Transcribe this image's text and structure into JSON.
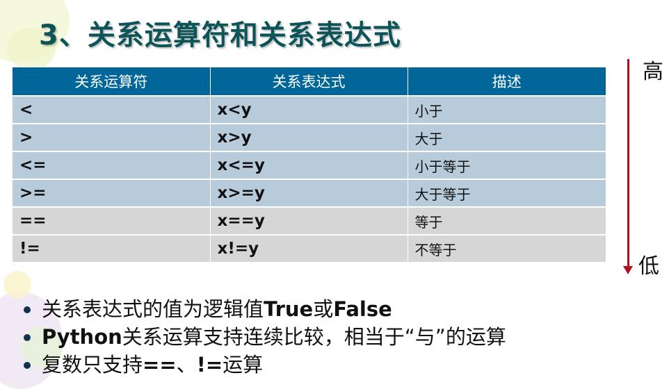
{
  "title": "3、关系运算符和关系表达式",
  "table": {
    "headers": [
      "关系运算符",
      "关系表达式",
      "描述"
    ],
    "rows": [
      {
        "op": "<",
        "expr": "x<y",
        "desc": "小于"
      },
      {
        "op": ">",
        "expr": "x>y",
        "desc": "大于"
      },
      {
        "op": "<=",
        "expr": "x<=y",
        "desc": "小于等于"
      },
      {
        "op": ">=",
        "expr": "x>=y",
        "desc": "大于等于"
      },
      {
        "op": "==",
        "expr": "x==y",
        "desc": "等于"
      },
      {
        "op": "!=",
        "expr": "x!=y",
        "desc": "不等于"
      }
    ]
  },
  "priority": {
    "high": "高",
    "low": "低",
    "arrow_color": "#b01021"
  },
  "bullets": [
    {
      "parts": [
        {
          "text": "关系表达式的值为逻辑值",
          "bold": false
        },
        {
          "text": "True",
          "bold": true
        },
        {
          "text": "或",
          "bold": false
        },
        {
          "text": "False",
          "bold": true
        }
      ]
    },
    {
      "parts": [
        {
          "text": "Python",
          "bold": true
        },
        {
          "text": "关系运算支持连续比较，相当于“与”的运算",
          "bold": false
        }
      ]
    },
    {
      "parts": [
        {
          "text": "复数只支持",
          "bold": false
        },
        {
          "text": "==",
          "bold": true
        },
        {
          "text": "、",
          "bold": false
        },
        {
          "text": "!=",
          "bold": true
        },
        {
          "text": "运算",
          "bold": false
        }
      ]
    }
  ],
  "colors": {
    "header_bg": "#006699",
    "row_blue": "#b7cbda",
    "row_grey": "#d6d6d6",
    "title": "#0d5458"
  }
}
